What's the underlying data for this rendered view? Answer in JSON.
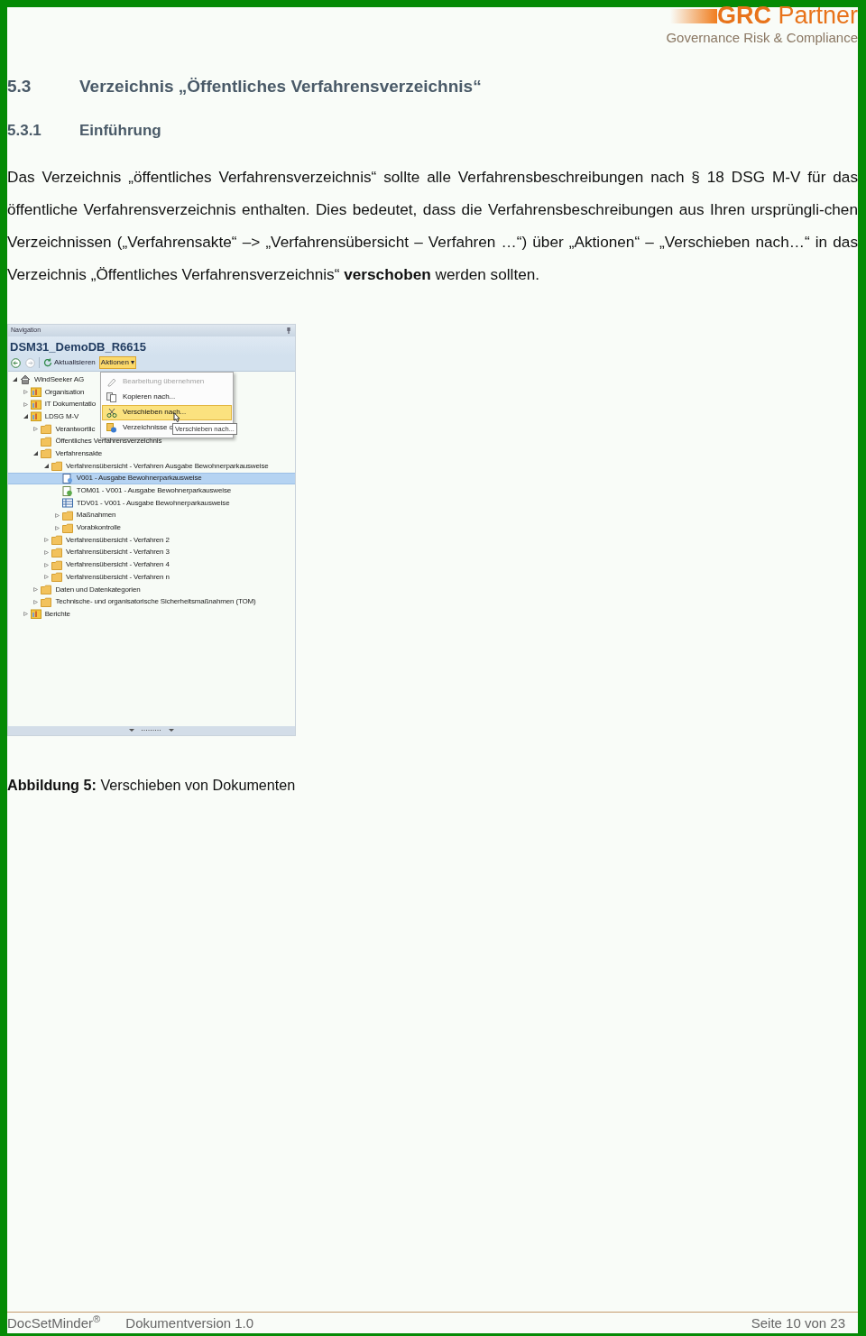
{
  "logo": {
    "name": "**GRC** Partner",
    "tagline": "Governance Risk & Compliance"
  },
  "section": {
    "number": "5.3",
    "title": "Verzeichnis „Öffentliches Verfahrensverzeichnis“"
  },
  "subsection": {
    "number": "5.3.1",
    "title": "Einführung"
  },
  "paragraph": "Das Verzeichnis „öffentliches Verfahrensverzeichnis“ sollte alle Verfahrensbeschreibungen nach § 18 DSG M-V für das öffentliche Verfahrensverzeichnis enthalten. Dies bedeutet, dass die Verfahrensbeschreibungen aus Ihren ursprüngli-chen Verzeichnissen („Verfahrensakte“ –> „Verfahrensübersicht – Verfahren …“) über „Aktionen“ – „Verschieben nach…“ in das Verzeichnis „Öffentliches Verfahrensverzeichnis“ **verschoben** werden sollten.",
  "figure": {
    "panel_title": "Navigation",
    "database": "DSM31_DemoDB_R6615",
    "toolbar": [
      {
        "kind": "back",
        "disabled": false
      },
      {
        "kind": "forward",
        "disabled": true
      },
      {
        "kind": "refresh",
        "label": "Aktualisieren"
      },
      {
        "kind": "dropdown",
        "label": "Aktionen",
        "caret": "▾"
      }
    ],
    "tree": [
      {
        "label": "WindSeeker AG",
        "kind": "home",
        "expanded": true,
        "selected": false,
        "children": [
          {
            "label": "Organisation",
            "kind": "module",
            "expanded": false,
            "selected": false
          },
          {
            "label": "IT Dokumentatio",
            "kind": "module",
            "expanded": false,
            "selected": false
          },
          {
            "label": "LDSG M-V",
            "kind": "module",
            "expanded": true,
            "selected": false,
            "children": [
              {
                "label": "Verantwortlic",
                "kind": "folder",
                "expanded": false,
                "selected": false
              },
              {
                "label": "Öffentliches Verfahrensverzeichnis",
                "kind": "folder",
                "selected": false
              },
              {
                "label": "Verfahrensakte",
                "kind": "folder",
                "expanded": true,
                "selected": false,
                "children": [
                  {
                    "label": "Verfahrensübersicht - Verfahren Ausgabe Bewohnerparkausweise",
                    "kind": "folder",
                    "expanded": true,
                    "selected": false,
                    "children": [
                      {
                        "label": "V001 - Ausgabe Bewohnerparkausweise",
                        "kind": "document",
                        "selected": true
                      },
                      {
                        "label": "TOM01 - V001 - Ausgabe Bewohnerparkausweise",
                        "kind": "measure",
                        "selected": false
                      },
                      {
                        "label": "TDV01 - V001 - Ausgabe Bewohnerparkausweise",
                        "kind": "table",
                        "selected": false
                      },
                      {
                        "label": "Maßnahmen",
                        "kind": "folder",
                        "expanded": false,
                        "selected": false
                      },
                      {
                        "label": "Vorabkontrolle",
                        "kind": "folder",
                        "expanded": false,
                        "selected": false
                      }
                    ]
                  },
                  {
                    "label": "Verfahrensübersicht - Verfahren 2",
                    "kind": "folder",
                    "expanded": false,
                    "selected": false
                  },
                  {
                    "label": "Verfahrensübersicht - Verfahren 3",
                    "kind": "folder",
                    "expanded": false,
                    "selected": false
                  },
                  {
                    "label": "Verfahrensübersicht - Verfahren 4",
                    "kind": "folder",
                    "expanded": false,
                    "selected": false
                  },
                  {
                    "label": "Verfahrensübersicht - Verfahren n",
                    "kind": "folder",
                    "expanded": false,
                    "selected": false
                  }
                ]
              },
              {
                "label": "Daten und Datenkategorien",
                "kind": "folder",
                "expanded": false,
                "selected": false
              },
              {
                "label": "Technische- und organisatorische Sicherheitsmaßnahmen (TOM)",
                "kind": "folder",
                "expanded": false,
                "selected": false
              }
            ]
          },
          {
            "label": "Berichte",
            "kind": "module",
            "expanded": false,
            "selected": false
          }
        ]
      }
    ],
    "menu": [
      {
        "label": "Bearbeitung übernehmen",
        "kind": "edit",
        "disabled": true,
        "selected": false
      },
      {
        "label": "Kopieren nach...",
        "kind": "copy",
        "disabled": false,
        "selected": false
      },
      {
        "label": "Verschieben nach...",
        "kind": "scissors",
        "disabled": false,
        "selected": true
      },
      {
        "label": "Verzeichnisse o",
        "kind": "info",
        "disabled": false,
        "selected": false
      }
    ],
    "tooltip": "Verschieben nach..."
  },
  "caption": "**Abbildung 5:** Verschieben von Dokumenten",
  "footer": {
    "product": "DocSetMinder$^{®}$",
    "version": "Dokumentversion 1.0",
    "page": "Seite 10 von 23"
  }
}
